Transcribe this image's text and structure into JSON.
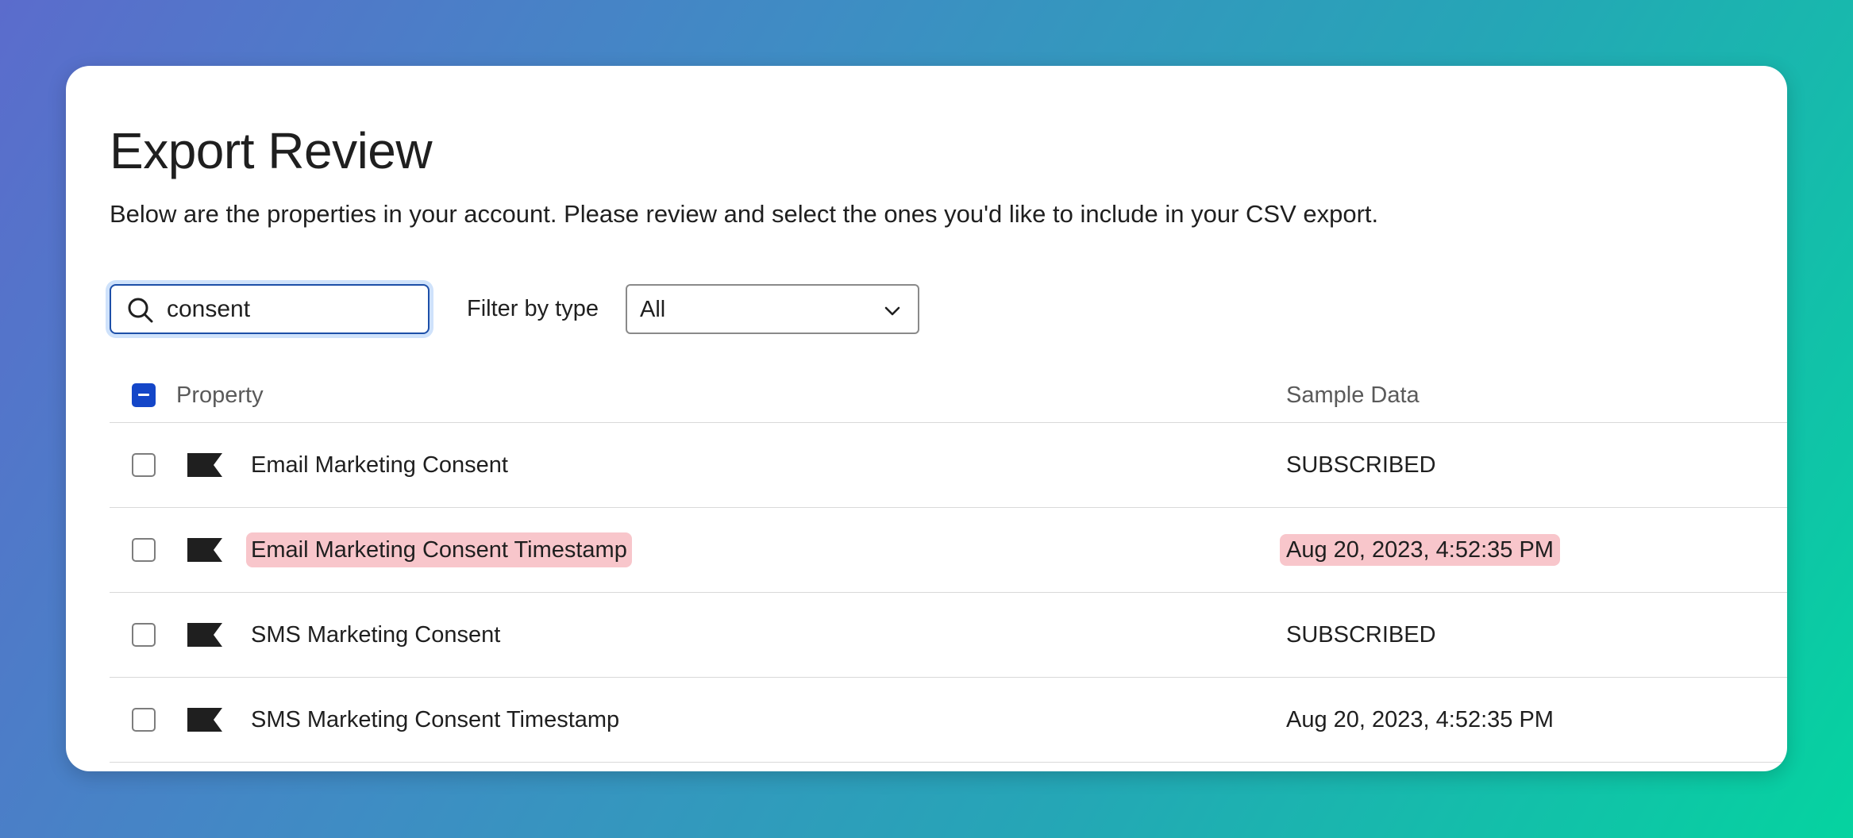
{
  "page": {
    "title": "Export Review",
    "subtitle": "Below are the properties in your account. Please review and select the ones you'd like to include in your CSV export."
  },
  "search": {
    "value": "consent",
    "icon": "search-icon"
  },
  "filter": {
    "label": "Filter by type",
    "selected": "All",
    "icon": "chevron-down-icon"
  },
  "table": {
    "headers": {
      "property": "Property",
      "sample_data": "Sample Data"
    },
    "select_all_state": "indeterminate",
    "rows": [
      {
        "property": "Email Marketing Consent",
        "sample": "SUBSCRIBED",
        "checked": false,
        "highlighted": false,
        "icon": "flag-icon"
      },
      {
        "property": "Email Marketing Consent Timestamp",
        "sample": "Aug 20, 2023, 4:52:35 PM",
        "checked": false,
        "highlighted": true,
        "icon": "flag-icon"
      },
      {
        "property": "SMS Marketing Consent",
        "sample": "SUBSCRIBED",
        "checked": false,
        "highlighted": false,
        "icon": "flag-icon"
      },
      {
        "property": "SMS Marketing Consent Timestamp",
        "sample": "Aug 20, 2023, 4:52:35 PM",
        "checked": false,
        "highlighted": false,
        "icon": "flag-icon"
      }
    ]
  },
  "colors": {
    "accent": "#1446c8",
    "highlight": "#f8c6cb",
    "focus_ring": "#cfe2fb"
  }
}
